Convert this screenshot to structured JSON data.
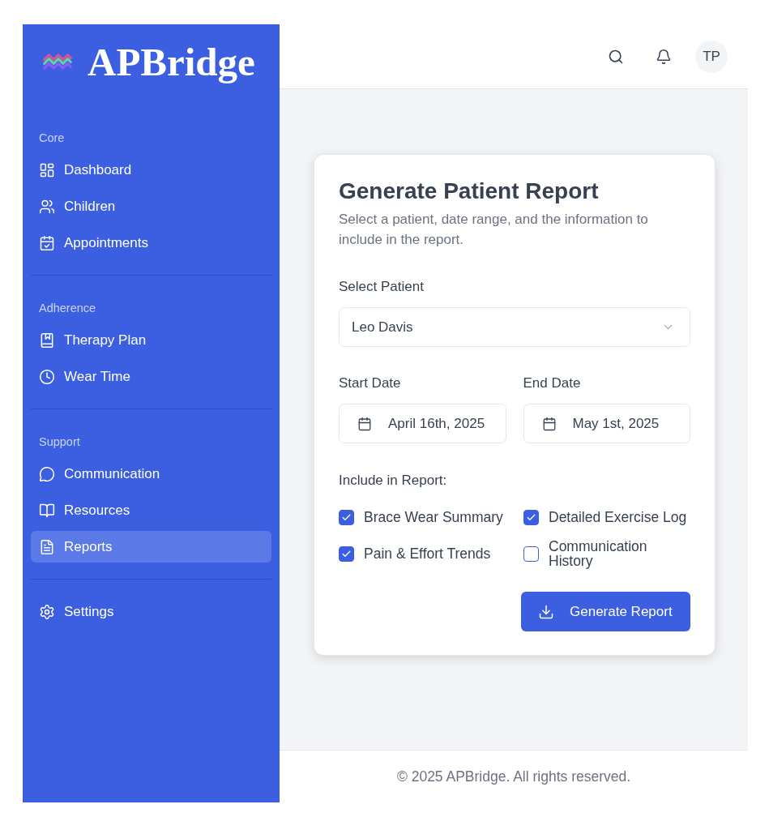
{
  "sidebar": {
    "brand": "APBridge",
    "sections": [
      {
        "label": "Core",
        "items": [
          {
            "label": "Dashboard",
            "selected": false
          },
          {
            "label": "Children",
            "selected": false
          },
          {
            "label": "Appointments",
            "selected": false
          }
        ]
      },
      {
        "label": "Adherence",
        "items": [
          {
            "label": "Therapy Plan",
            "selected": false
          },
          {
            "label": "Wear Time",
            "selected": false
          }
        ]
      },
      {
        "label": "Support",
        "items": [
          {
            "label": "Communication",
            "selected": false
          },
          {
            "label": "Resources",
            "selected": false
          },
          {
            "label": "Reports",
            "selected": true
          }
        ]
      },
      {
        "items": [
          {
            "label": "Settings",
            "selected": false
          }
        ]
      }
    ]
  },
  "header": {
    "avatar_initials": "TP"
  },
  "report_card": {
    "title": "Generate Patient Report",
    "subtitle": "Select a patient, date range, and the information to include in the report.",
    "patient_select": {
      "label": "Select Patient",
      "value": "Leo Davis"
    },
    "date_fields": [
      {
        "label": "Start Date",
        "value": "April 16th, 2025"
      },
      {
        "label": "End Date",
        "value": "May 1st, 2025"
      }
    ],
    "include": {
      "label": "Include in Report:",
      "options": [
        {
          "label": "Brace Wear Summary",
          "checked": true
        },
        {
          "label": "Detailed Exercise Log",
          "checked": true
        },
        {
          "label": "Pain & Effort Trends",
          "checked": true
        },
        {
          "label": "Communication History",
          "checked": false
        }
      ]
    },
    "submit_button": "Generate Report"
  },
  "footer": {
    "text": "© 2025 APBridge. All rights reserved."
  }
}
